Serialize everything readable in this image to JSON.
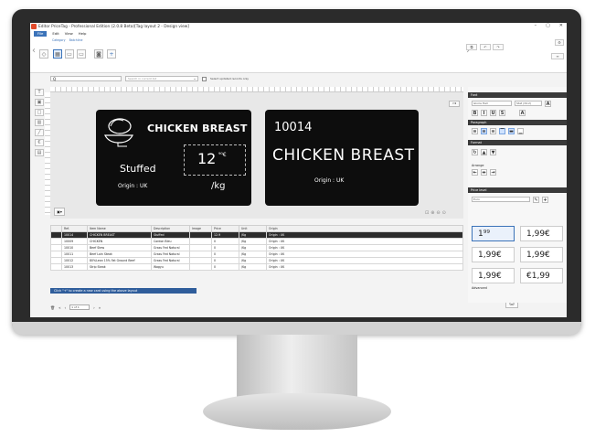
{
  "window": {
    "title": "Editor PriceTag - Professional Edition (2.0.8 Beta)[Tag layout 2 - Design view]",
    "minimize": "–",
    "maximize": "▢",
    "close": "✕"
  },
  "menu": {
    "items": [
      "File",
      "Edit",
      "View",
      "Help"
    ]
  },
  "ribbon": {
    "tabs": [
      "Category",
      "Batchline"
    ]
  },
  "search": {
    "value": "Q",
    "combo_placeholder": "Search in current list",
    "checkbox_label": "Select updated records only"
  },
  "label_front": {
    "title": "CHICKEN BREAST",
    "subtitle": "Stuffed",
    "origin": "Origin : UK",
    "price_main": "12",
    "price_cents": "⁹⁰€",
    "unit": "/kg"
  },
  "label_back": {
    "code": "10014",
    "title": "CHICKEN BREAST",
    "origin": "Origin : UK"
  },
  "table": {
    "headers": [
      "",
      "Ref.",
      "Item Name",
      "Description",
      "Image",
      "Price",
      "Unit",
      "Origin"
    ],
    "rows": [
      [
        "",
        "10014",
        "CHICKEN BREAST",
        "Stuffed",
        "",
        "12.9",
        "/Kg",
        "Origin : UK"
      ],
      [
        "",
        "10009",
        "CHICKEN",
        "Cordon Bleu",
        "",
        "0",
        "/Kg",
        "Origin : UK"
      ],
      [
        "",
        "10010",
        "Beef Stew",
        "Grass Fed Natural",
        "",
        "0",
        "/Kg",
        "Origin : UK"
      ],
      [
        "",
        "10011",
        "Beef Loin Steak",
        "Grass Fed Natural",
        "",
        "0",
        "/Kg",
        "Origin : UK"
      ],
      [
        "",
        "10012",
        "80%Lean 15% Fat Ground Beef",
        "Grass Fed Natural",
        "",
        "0",
        "/Kg",
        "Origin : UK"
      ],
      [
        "",
        "10013",
        "Strip Steak",
        "Wagyu",
        "",
        "0",
        "/Kg",
        "Origin : UK"
      ]
    ],
    "hint": "Click \"+\" to create a new card using the above layout"
  },
  "status": {
    "page": "1 of 1"
  },
  "panel": {
    "font_head": "Font",
    "font_name": "Gloria Hall",
    "font_size": "Stat (34.2)",
    "paragraph_head": "Paragraph",
    "format_head": "Format",
    "arrange_head": "Arrange",
    "price_head": "Price level",
    "price_select": "Euro",
    "advanced": "Advanced",
    "price_styles": [
      "1⁹⁹",
      "1,99€",
      "1,99€",
      "1,99€",
      "1,99€",
      "€1,99"
    ]
  }
}
